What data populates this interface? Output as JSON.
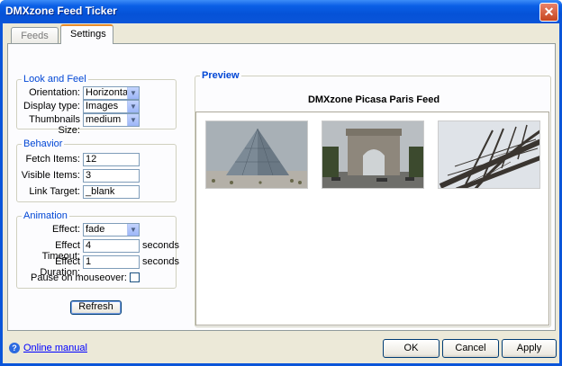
{
  "window": {
    "title": "DMXzone Feed Ticker",
    "close_glyph": "✕"
  },
  "tabs": [
    {
      "label": "Feeds"
    },
    {
      "label": "Settings"
    }
  ],
  "look_and_feel": {
    "legend": "Look and Feel",
    "orientation_label": "Orientation:",
    "orientation_value": "Horizontal",
    "display_type_label": "Display type:",
    "display_type_value": "Images",
    "thumb_size_label": "Thumbnails Size:",
    "thumb_size_value": "medium"
  },
  "behavior": {
    "legend": "Behavior",
    "fetch_items_label": "Fetch Items:",
    "fetch_items_value": "12",
    "visible_items_label": "Visible Items:",
    "visible_items_value": "3",
    "link_target_label": "Link Target:",
    "link_target_value": "_blank"
  },
  "animation": {
    "legend": "Animation",
    "effect_label": "Effect:",
    "effect_value": "fade",
    "timeout_label": "Effect Timeout:",
    "timeout_value": "4",
    "timeout_unit": "seconds",
    "duration_label": "Effect Duration:",
    "duration_value": "1",
    "duration_unit": "seconds",
    "pause_label": "Pause on mouseover:",
    "pause_checked": false
  },
  "refresh_label": "Refresh",
  "preview": {
    "legend": "Preview",
    "feed_title": "DMXzone Picasa Paris Feed",
    "thumbnails": [
      "louvre-pyramid",
      "arc-de-triomphe",
      "eiffel-tower"
    ]
  },
  "footer": {
    "help_link": "Online manual",
    "ok_label": "OK",
    "cancel_label": "Cancel",
    "apply_label": "Apply"
  },
  "colors": {
    "title_bar": "#0b55d9",
    "dialog_bg": "#ece9d8",
    "legend_text": "#0046d5",
    "link": "#0000ff"
  }
}
